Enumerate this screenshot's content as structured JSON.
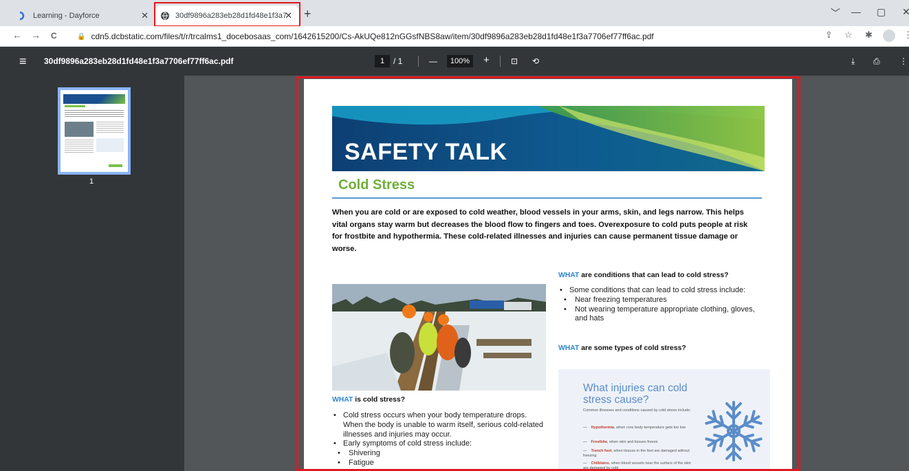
{
  "browser": {
    "tabs": [
      {
        "title": "Learning - Dayforce",
        "active": false
      },
      {
        "title": "30df9896a283eb28d1fd48e1f3a7",
        "active": true
      }
    ],
    "new_tab": "+",
    "window_controls": {
      "menu": "﹀",
      "minimize": "—",
      "maximize": "▢",
      "close": "✕"
    },
    "url": "cdn5.dcbstatic.com/files/t/r/trcalms1_docebosaas_com/1642615200/Cs-AkUQe812nGGsfNBS8aw/item/30df9896a283eb28d1fd48e1f3a7706ef77ff6ac.pdf",
    "nav": {
      "back": "←",
      "forward": "→",
      "reload": "C"
    }
  },
  "pdf_viewer": {
    "filename": "30df9896a283eb28d1fd48e1f3a7706ef77ff6ac.pdf",
    "page_current": "1",
    "page_total": "/ 1",
    "zoom": "100%",
    "zoom_out": "—",
    "zoom_in": "+",
    "thumbnail_label": "1"
  },
  "document": {
    "banner_title": "SAFETY TALK",
    "heading": "Cold Stress",
    "intro": "When you are cold or are exposed to cold weather, blood vessels in your arms, skin, and legs narrow. This helps vital organs stay warm but decreases the blood flow to fingers and toes. Overexposure to cold puts people at risk for frostbite and hypothermia. These cold-related illnesses and injuries can cause permanent tissue damage or worse.",
    "q1": {
      "what": "WHAT",
      "rest": " are conditions that can lead to cold stress?"
    },
    "q1_items": [
      "Some conditions that can lead to cold stress include:",
      "Near freezing temperatures",
      "Not wearing temperature appropriate clothing, gloves, and hats"
    ],
    "q2": {
      "what": "WHAT",
      "rest": " are some types of cold stress?"
    },
    "q3": {
      "what": "WHAT",
      "rest": " is cold stress?"
    },
    "q3_items": [
      "Cold stress occurs when your body temperature drops. When the body is unable to warm itself, serious cold-related illnesses and injuries may occur.",
      "Early symptoms of cold stress include:",
      "Shivering",
      "Fatigue"
    ],
    "infobox": {
      "title": "What injuries can cold stress cause?",
      "subtitle": "Common illnesses and conditions caused by cold stress include:",
      "items": [
        {
          "term": "Hypothermia",
          "desc": ", when core body temperature gets too low"
        },
        {
          "term": "Frostbite",
          "desc": ", when skin and tissues freeze"
        },
        {
          "term": "Trench foot",
          "desc": ", when tissues in the feet are damaged without freezing"
        },
        {
          "term": "Chilblains",
          "desc": ", when blood vessels near the surface of the skin are damaged by cold"
        }
      ]
    }
  }
}
